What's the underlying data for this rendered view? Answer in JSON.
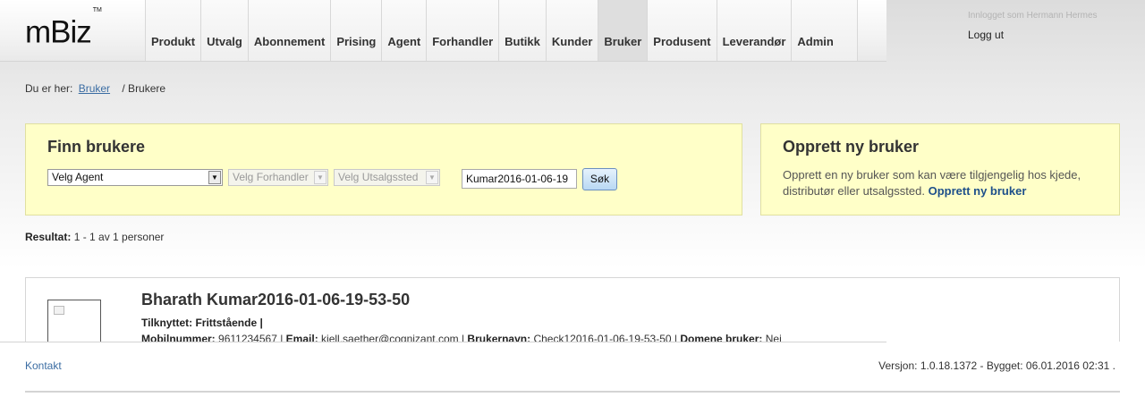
{
  "app": {
    "logo": "mBiz",
    "trademark": "TM"
  },
  "nav": {
    "items": [
      {
        "label": "Produkt"
      },
      {
        "label": "Utvalg"
      },
      {
        "label": "Abonnement"
      },
      {
        "label": "Prising"
      },
      {
        "label": "Agent"
      },
      {
        "label": "Forhandler"
      },
      {
        "label": "Butikk"
      },
      {
        "label": "Kunder"
      },
      {
        "label": "Bruker",
        "active": true
      },
      {
        "label": "Produsent"
      },
      {
        "label": "Leverandør"
      },
      {
        "label": "Admin"
      }
    ]
  },
  "user_area": {
    "logged_in_text": "Innlogget som Hermann Hermes",
    "logout_label": "Logg ut"
  },
  "breadcrumb": {
    "prefix": "Du er her:",
    "link": "Bruker",
    "current": "/ Brukere"
  },
  "search_panel": {
    "title": "Finn brukere",
    "agent_select": "Velg Agent",
    "forhandler_select": "Velg Forhandler",
    "utsalgssted_select": "Velg Utsalgssted",
    "search_value": "Kumar2016-01-06-19",
    "search_button": "Søk"
  },
  "create_panel": {
    "title": "Opprett ny bruker",
    "description": "Opprett en ny bruker som kan være tilgjengelig hos kjede, distributør eller utsalgssted.",
    "link": "Opprett ny bruker"
  },
  "results": {
    "label": "Resultat:",
    "text": "1 - 1 av 1 personer",
    "users": [
      {
        "name": "Bharath Kumar2016-01-06-19-53-50",
        "tilknyttet_label": "Tilknyttet: Frittstående |",
        "mobil_label": "Mobilnummer:",
        "mobil": "9611234567 |",
        "email_label": "Email:",
        "email": "kjell.saether@cognizant.com |",
        "brukernavn_label": "Brukernavn:",
        "brukernavn": "Check12016-01-06-19-53-50 |",
        "domene_label": "Domene bruker:",
        "domene": "Nei"
      }
    ]
  },
  "footer": {
    "kontakt": "Kontakt",
    "version": "Versjon: 1.0.18.1372 - Bygget: 06.01.2016 02:31 ."
  }
}
